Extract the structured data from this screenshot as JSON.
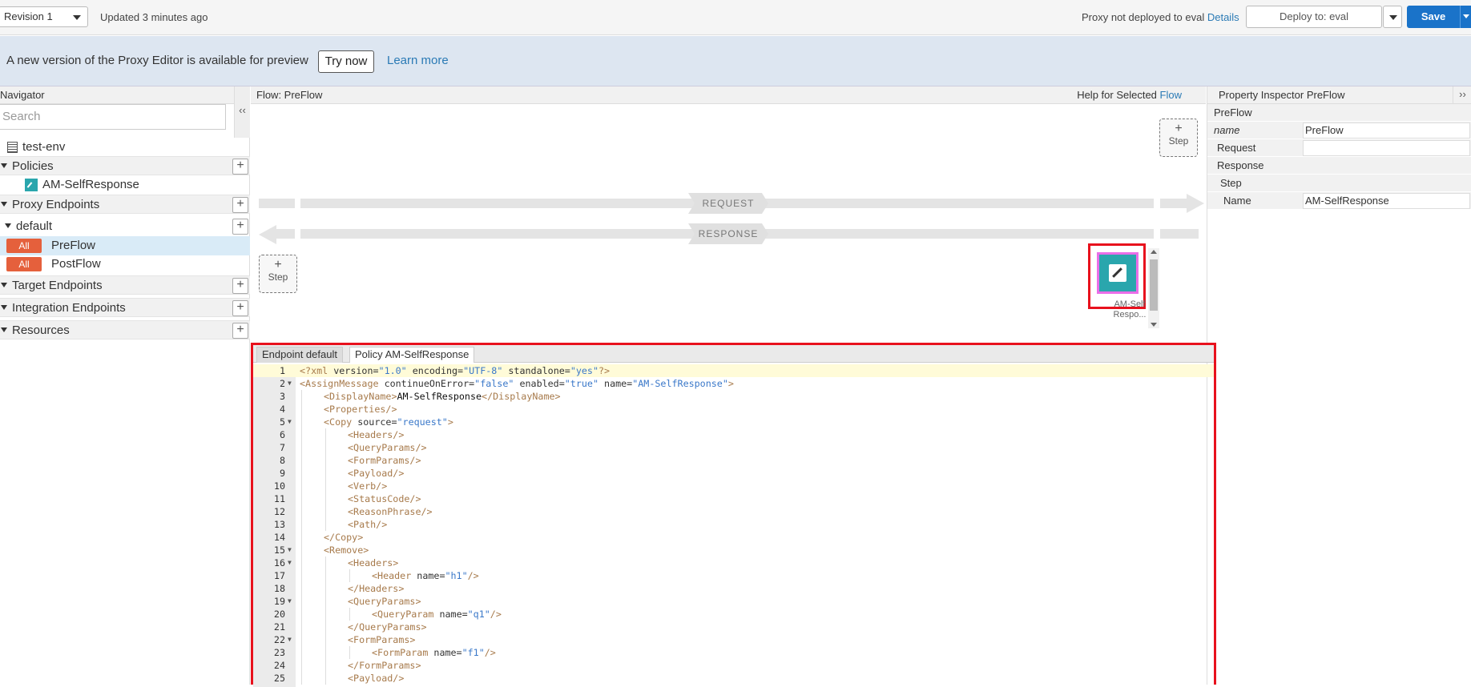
{
  "topbar": {
    "revision": "Revision 1",
    "updated": "Updated 3 minutes ago",
    "deploy_status": "Proxy not deployed to eval",
    "details_link": "Details",
    "deploy_to": "Deploy to: eval",
    "save": "Save"
  },
  "banner": {
    "text": "A new version of the Proxy Editor is available for preview",
    "try_now": "Try now",
    "learn_more": "Learn more"
  },
  "navigator": {
    "title": "Navigator",
    "collapse": "‹‹",
    "search_placeholder": "Search",
    "env": "test-env",
    "policies": "Policies",
    "policy_item": "AM-SelfResponse",
    "proxy_endpoints": "Proxy Endpoints",
    "default": "default",
    "tag_all": "All",
    "preflow": "PreFlow",
    "postflow": "PostFlow",
    "target_endpoints": "Target Endpoints",
    "integration_endpoints": "Integration Endpoints",
    "resources": "Resources",
    "plus": "+"
  },
  "flow": {
    "title": "Flow: PreFlow",
    "help_prefix": "Help for Selected",
    "help_link": "Flow",
    "step_plus": "+",
    "step": "Step",
    "request": "REQUEST",
    "response": "RESPONSE",
    "policy_caption_1": "AM-Self",
    "policy_caption_2": "Respo..."
  },
  "inspector": {
    "title": "Property Inspector  PreFlow",
    "collapse": "››",
    "rows": {
      "preflow": "PreFlow",
      "name_key": "name",
      "name_val": "PreFlow",
      "request": "Request",
      "response": "Response",
      "step": "Step",
      "step_name_key": "Name",
      "step_name_val": "AM-SelfResponse"
    }
  },
  "editor": {
    "tab_endpoint": "Endpoint default",
    "tab_policy": "Policy AM-SelfResponse",
    "lines": [
      {
        "n": "1",
        "fold": false
      },
      {
        "n": "2",
        "fold": true
      },
      {
        "n": "3",
        "fold": false
      },
      {
        "n": "4",
        "fold": false
      },
      {
        "n": "5",
        "fold": true
      },
      {
        "n": "6",
        "fold": false
      },
      {
        "n": "7",
        "fold": false
      },
      {
        "n": "8",
        "fold": false
      },
      {
        "n": "9",
        "fold": false
      },
      {
        "n": "10",
        "fold": false
      },
      {
        "n": "11",
        "fold": false
      },
      {
        "n": "12",
        "fold": false
      },
      {
        "n": "13",
        "fold": false
      },
      {
        "n": "14",
        "fold": false
      },
      {
        "n": "15",
        "fold": true
      },
      {
        "n": "16",
        "fold": true
      },
      {
        "n": "17",
        "fold": false
      },
      {
        "n": "18",
        "fold": false
      },
      {
        "n": "19",
        "fold": true
      },
      {
        "n": "20",
        "fold": false
      },
      {
        "n": "21",
        "fold": false
      },
      {
        "n": "22",
        "fold": true
      },
      {
        "n": "23",
        "fold": false
      },
      {
        "n": "24",
        "fold": false
      },
      {
        "n": "25",
        "fold": false
      }
    ],
    "code": {
      "l1": [
        "<?xml ",
        "version=",
        "\"1.0\"",
        " encoding=",
        "\"UTF-8\"",
        " standalone=",
        "\"yes\"",
        "?>"
      ],
      "l2": [
        "<AssignMessage ",
        "continueOnError=",
        "\"false\"",
        " enabled=",
        "\"true\"",
        " name=",
        "\"AM-SelfResponse\"",
        ">"
      ],
      "l3": [
        "<DisplayName>",
        "AM-SelfResponse",
        "</DisplayName>"
      ],
      "l4": "<Properties/>",
      "l5": [
        "<Copy ",
        "source=",
        "\"request\"",
        ">"
      ],
      "l6": "<Headers/>",
      "l7": "<QueryParams/>",
      "l8": "<FormParams/>",
      "l9": "<Payload/>",
      "l10": "<Verb/>",
      "l11": "<StatusCode/>",
      "l12": "<ReasonPhrase/>",
      "l13": "<Path/>",
      "l14": "</Copy>",
      "l15": "<Remove>",
      "l16": "<Headers>",
      "l17": [
        "<Header ",
        "name=",
        "\"h1\"",
        "/>"
      ],
      "l18": "</Headers>",
      "l19": "<QueryParams>",
      "l20": [
        "<QueryParam ",
        "name=",
        "\"q1\"",
        "/>"
      ],
      "l21": "</QueryParams>",
      "l22": "<FormParams>",
      "l23": [
        "<FormParam ",
        "name=",
        "\"f1\"",
        "/>"
      ],
      "l24": "</FormParams>",
      "l25": "<Payload/>"
    }
  },
  "colors": {
    "accent": "#1a73c9",
    "tag_all": "#e5603c",
    "policy_teal": "#2aa6ad",
    "highlight_red": "#e8111d",
    "highlight_pink": "#ea6ee8"
  }
}
